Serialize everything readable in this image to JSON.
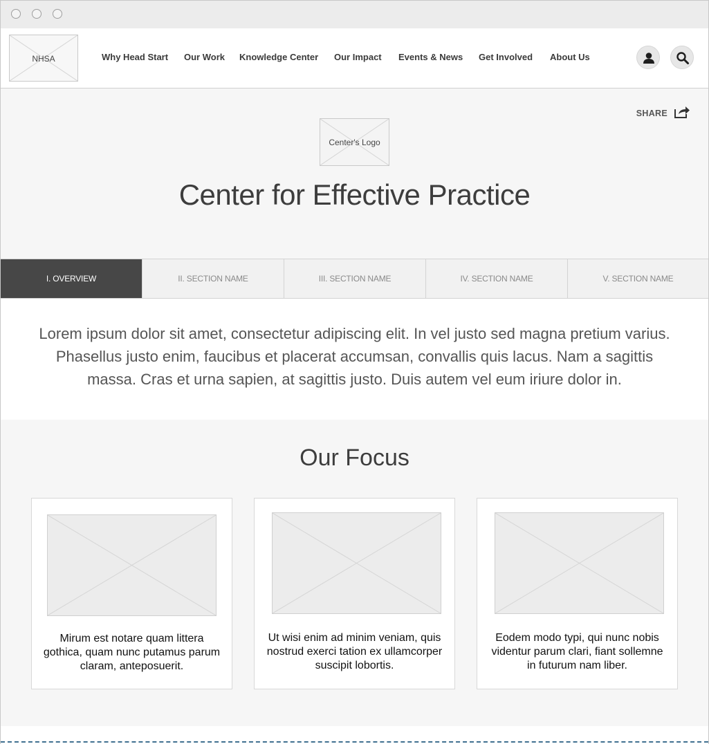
{
  "header": {
    "logo_label": "NHSA",
    "nav": [
      "Why Head Start",
      "Our Work",
      "Knowledge Center",
      "Our Impact",
      "Events & News",
      "Get Involved",
      "About Us"
    ],
    "icons": [
      "user-icon",
      "search-icon"
    ]
  },
  "hero": {
    "share_label": "SHARE",
    "center_logo_label": "Center's Logo",
    "title": "Center for Effective Practice"
  },
  "tabs": [
    {
      "label": "I. OVERVIEW",
      "active": true
    },
    {
      "label": "II. SECTION NAME",
      "active": false
    },
    {
      "label": "III. SECTION NAME",
      "active": false
    },
    {
      "label": "IV. SECTION NAME",
      "active": false
    },
    {
      "label": "V. SECTION NAME",
      "active": false
    }
  ],
  "intro": {
    "text": "Lorem ipsum dolor sit amet, consectetur adipiscing elit. In vel justo sed magna pretium varius. Phasellus justo enim, faucibus et placerat accumsan, convallis quis lacus. Nam a sagittis massa. Cras et urna sapien, at sagittis justo. Duis autem vel eum iriure dolor in."
  },
  "focus": {
    "title": "Our Focus",
    "cards": [
      {
        "text": "Mirum est notare quam littera gothica, quam nunc putamus parum claram, anteposuerit."
      },
      {
        "text": "Ut wisi enim ad minim veniam, quis nostrud exerci tation ex ullamcorper suscipit lobortis."
      },
      {
        "text": "Eodem modo typi, qui nunc nobis videntur parum clari, fiant sollemne in futurum nam liber."
      }
    ]
  },
  "colors": {
    "tab_active_bg": "#474747",
    "hero_bg": "#f6f6f6",
    "divider": "#3f6f8f"
  }
}
